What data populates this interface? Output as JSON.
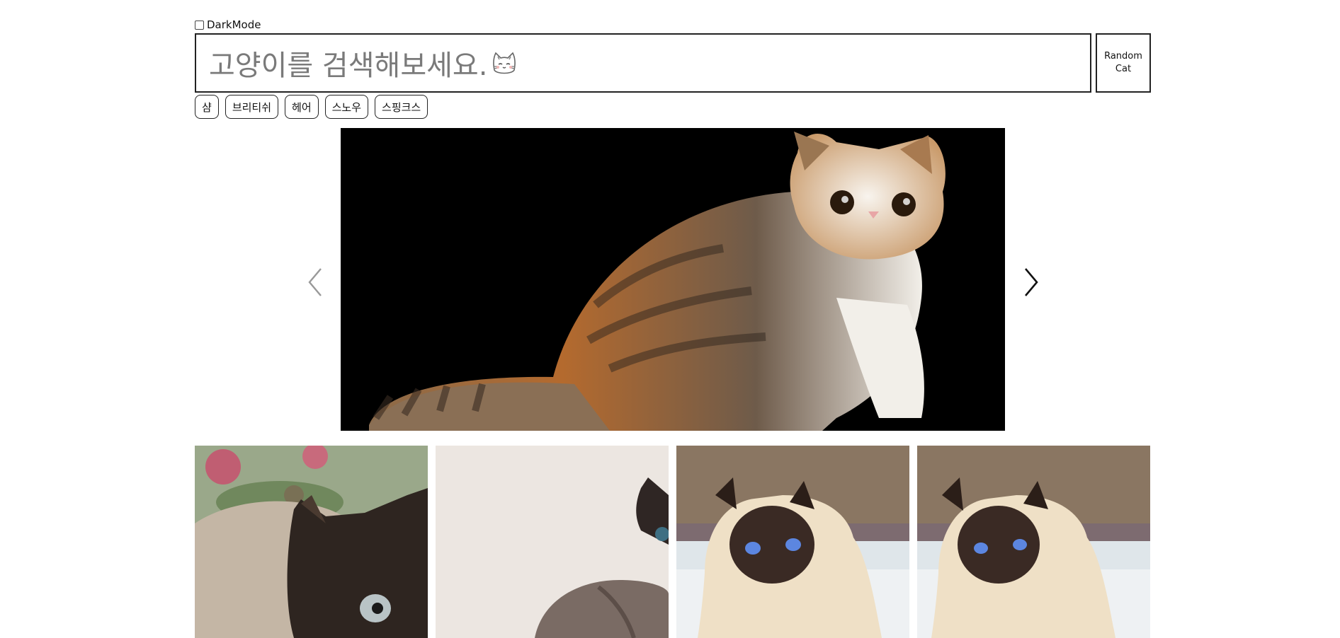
{
  "darkmode": {
    "label": "DarkMode",
    "checked": false
  },
  "search": {
    "placeholder": "고양이를 검색해보세요.",
    "icon": "cat-face-icon"
  },
  "random_button": {
    "label": "Random\nCat"
  },
  "keywords": [
    "샴",
    "브리티쉬",
    "헤어",
    "스노우",
    "스핑크스"
  ],
  "slider": {
    "prev_icon": "chevron-left-icon",
    "next_icon": "chevron-right-icon",
    "current_image": "calico exotic shorthair cat on black background"
  },
  "results": [
    {
      "image": "siamese cat close-up with flowers"
    },
    {
      "image": "sphynx-like siamese cat peeking from right"
    },
    {
      "image": "siamese cat with blue eyes outdoors"
    },
    {
      "image": "siamese cat with blue eyes outdoors"
    }
  ],
  "colors": {
    "border": "#222222",
    "placeholder": "#7a7a7a",
    "background": "#ffffff"
  }
}
